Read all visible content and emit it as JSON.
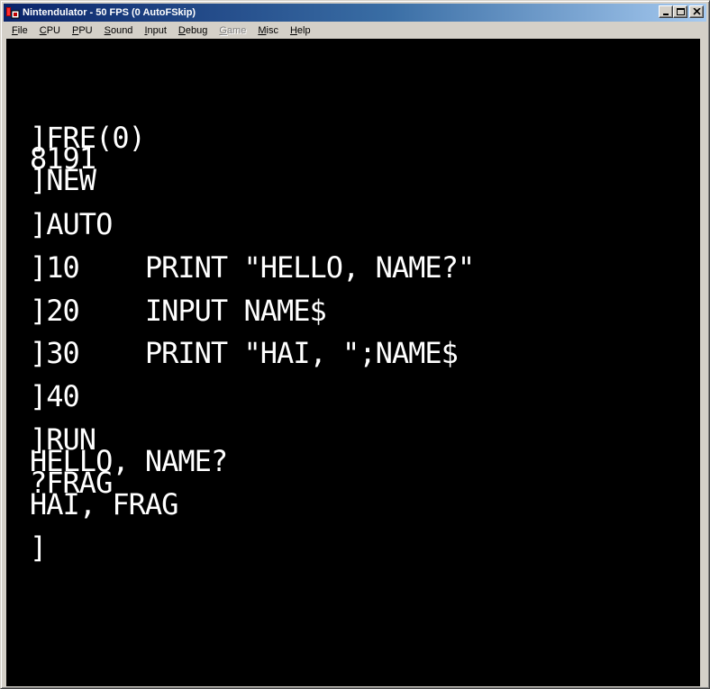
{
  "window": {
    "title": "Nintendulator - 50 FPS (0 AutoFSkip)",
    "controls": [
      "minimize",
      "maximize",
      "close"
    ]
  },
  "menubar": {
    "items": [
      {
        "label": "File",
        "accel": "F",
        "rest": "ile",
        "enabled": true
      },
      {
        "label": "CPU",
        "accel": "C",
        "rest": "PU",
        "enabled": true
      },
      {
        "label": "PPU",
        "accel": "P",
        "rest": "PU",
        "enabled": true
      },
      {
        "label": "Sound",
        "accel": "S",
        "rest": "ound",
        "enabled": true
      },
      {
        "label": "Input",
        "accel": "I",
        "rest": "nput",
        "enabled": true
      },
      {
        "label": "Debug",
        "accel": "D",
        "rest": "ebug",
        "enabled": true
      },
      {
        "label": "Game",
        "accel": "G",
        "rest": "ame",
        "enabled": false
      },
      {
        "label": "Misc",
        "accel": "M",
        "rest": "isc",
        "enabled": true
      },
      {
        "label": "Help",
        "accel": "H",
        "rest": "elp",
        "enabled": true
      }
    ]
  },
  "screen": {
    "lines": [
      "]FRE(0)",
      "8191",
      "]NEW",
      "]AUTO",
      "]10    PRINT \"HELLO, NAME?\"",
      "]20    INPUT NAME$",
      "]30    PRINT \"HAI, \";NAME$",
      "]40",
      "]RUN",
      "HELLO, NAME?",
      "?FRAG",
      "HAI, FRAG",
      "]"
    ]
  },
  "colors": {
    "titlebar_start": "#0a246a",
    "titlebar_end": "#a6caf0",
    "screen_bg": "#000000",
    "screen_text": "#ffffff"
  }
}
